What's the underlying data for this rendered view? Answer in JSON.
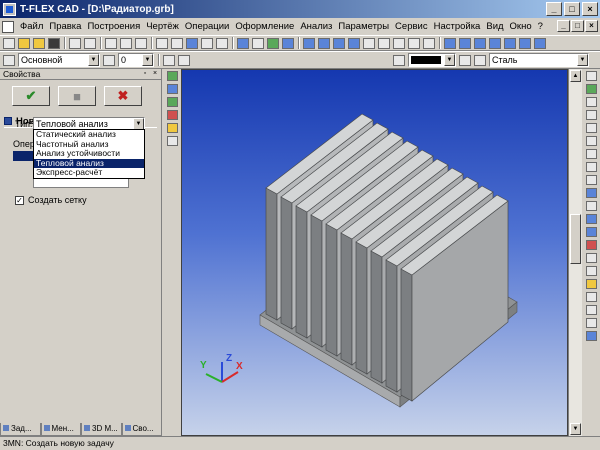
{
  "window": {
    "title": "T-FLEX CAD - [D:\\Радиатор.grb]",
    "controls": [
      "_",
      "□",
      "×"
    ]
  },
  "menu": {
    "items": [
      "Файл",
      "Правка",
      "Построения",
      "Чертёж",
      "Операции",
      "Оформление",
      "Анализ",
      "Параметры",
      "Сервис",
      "Настройка",
      "Вид",
      "Окно",
      "?"
    ]
  },
  "toolbar2": {
    "style_value": "Основной",
    "layer_value": "0",
    "material_value": "Сталь"
  },
  "panel": {
    "caption": "Свойства",
    "section_title": "Новая задача",
    "type_label": "Тип:",
    "type_value": "Тепловой анализ",
    "operation_label": "Опер",
    "dropdown_options": [
      "Статический анализ",
      "Частотный анализ",
      "Анализ устойчивости",
      "Тепловой анализ",
      "Экспресс-расчёт"
    ],
    "selected_index": 3,
    "checkbox_label": "Создать сетку",
    "checkbox_checked": true
  },
  "tabs": [
    "Зад...",
    "Мен...",
    "3D М...",
    "Сво..."
  ],
  "status": {
    "text": "3MN: Создать новую задачу"
  },
  "axes": {
    "x": "X",
    "y": "Y",
    "z": "Z"
  },
  "colors": {
    "title_bar": "#0a246a",
    "viewport_top": "#1538b0",
    "viewport_bottom": "#c6d2ea",
    "model": "#b4b6b8"
  }
}
